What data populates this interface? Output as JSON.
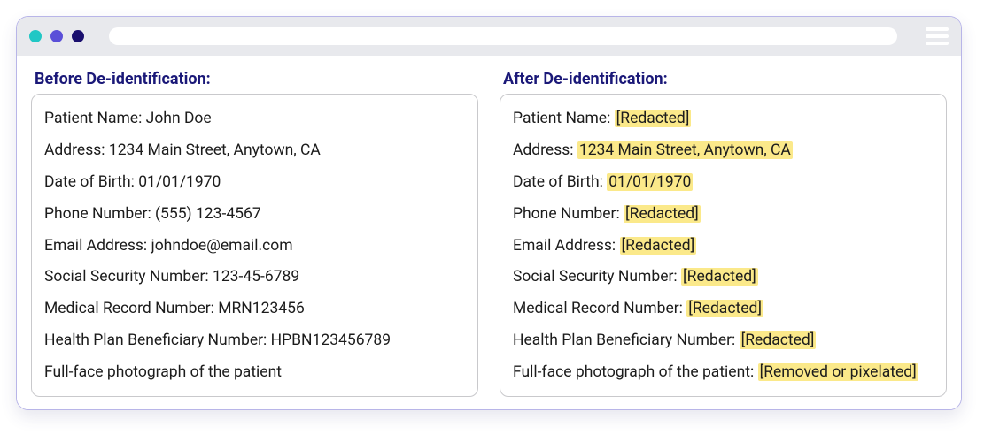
{
  "window": {
    "dot_colors": [
      "#21c7c5",
      "#5a4fd8",
      "#1a0f6e"
    ]
  },
  "before": {
    "title": "Before De-identification:",
    "rows": [
      {
        "label": "Patient Name: ",
        "value": "John Doe",
        "highlight": false
      },
      {
        "label": "Address: ",
        "value": "1234 Main Street, Anytown, CA",
        "highlight": false
      },
      {
        "label": "Date of Birth: ",
        "value": "01/01/1970",
        "highlight": false
      },
      {
        "label": "Phone Number: ",
        "value": "(555) 123-4567",
        "highlight": false
      },
      {
        "label": "Email Address: ",
        "value": "johndoe@email.com",
        "highlight": false
      },
      {
        "label": "Social Security Number: ",
        "value": "123-45-6789",
        "highlight": false
      },
      {
        "label": "Medical Record Number: ",
        "value": "MRN123456",
        "highlight": false
      },
      {
        "label": "Health Plan Beneficiary Number: ",
        "value": "HPBN123456789",
        "highlight": false
      },
      {
        "label": "Full-face photograph of the patient",
        "value": "",
        "highlight": false
      }
    ]
  },
  "after": {
    "title": "After De-identification:",
    "rows": [
      {
        "label": "Patient Name: ",
        "value": "[Redacted]",
        "highlight": true
      },
      {
        "label": "Address: ",
        "value": "1234 Main Street, Anytown, CA",
        "highlight": true
      },
      {
        "label": "Date of Birth: ",
        "value": "01/01/1970",
        "highlight": true
      },
      {
        "label": "Phone Number: ",
        "value": "[Redacted]",
        "highlight": true
      },
      {
        "label": "Email Address: ",
        "value": "[Redacted]",
        "highlight": true
      },
      {
        "label": "Social Security Number: ",
        "value": "[Redacted]",
        "highlight": true
      },
      {
        "label": "Medical Record Number: ",
        "value": "[Redacted]",
        "highlight": true
      },
      {
        "label": "Health Plan Beneficiary Number: ",
        "value": "[Redacted]",
        "highlight": true
      },
      {
        "label": "Full-face photograph of the patient: ",
        "value": "[Removed or pixelated]",
        "highlight": true
      }
    ]
  }
}
